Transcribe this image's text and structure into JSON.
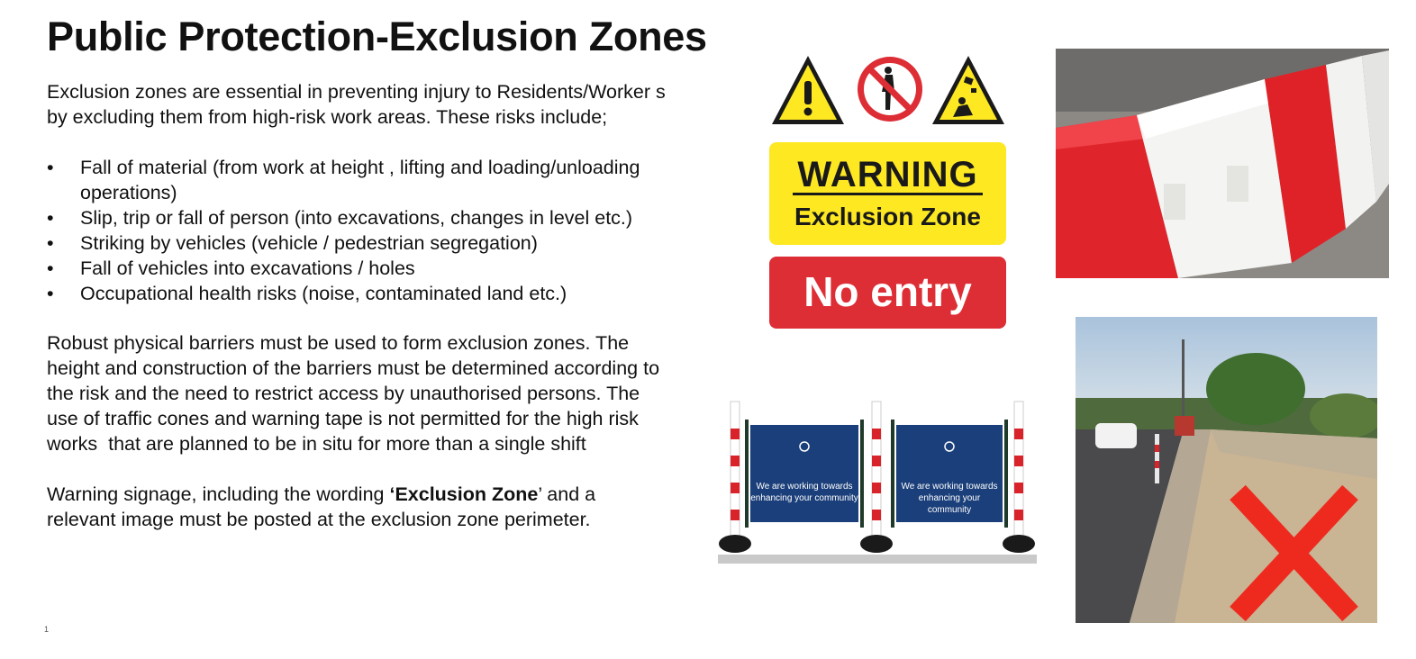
{
  "slide": {
    "title": "Public Protection-Exclusion Zones",
    "intro_line1": "Exclusion zones are essential in preventing injury to Residents/Worker s",
    "intro_line2": "by excluding them from high-risk work areas. These risks include;",
    "bullet_glyph": "•",
    "risks": [
      "Fall of material (from work at height , lifting and loading/unloading operations)",
      "Slip, trip or fall of person (into excavations, changes in level etc.)",
      "Striking by vehicles (vehicle / pedestrian segregation)",
      "Fall of vehicles into excavations / holes",
      "Occupational health risks (noise, contaminated land etc.)"
    ],
    "para2_lines": [
      "Robust physical barriers must be used to form exclusion zones. The",
      "height and construction of the barriers must be determined according to",
      "the risk and the need to restrict access by unauthorised persons. The",
      "use of traffic cones and warning tape is not permitted for the high risk",
      "works  that are planned to be in situ for more than a single shift"
    ],
    "para3_prefix": "Warning signage, including the wording ",
    "para3_bold": "‘Exclusion Zone",
    "para3_suffix": "’ and a",
    "para3_line2": "relevant image must be posted at the exclusion zone perimeter.",
    "page_number": "1"
  },
  "signs": {
    "warning_word": "WARNING",
    "warning_sub": "Exclusion Zone",
    "no_entry": "No entry",
    "icons": [
      "exclamation-warning-icon",
      "no-pedestrians-icon",
      "falling-objects-icon"
    ]
  },
  "fence_banner": {
    "line1": "We are working towards",
    "line2": "enhancing your community"
  },
  "colors": {
    "sign_yellow": "#fde822",
    "sign_red": "#dd2d35",
    "barrier_red": "#e0242b",
    "banner_blue": "#1b3f7a",
    "cross_red": "#ee2a1e"
  }
}
